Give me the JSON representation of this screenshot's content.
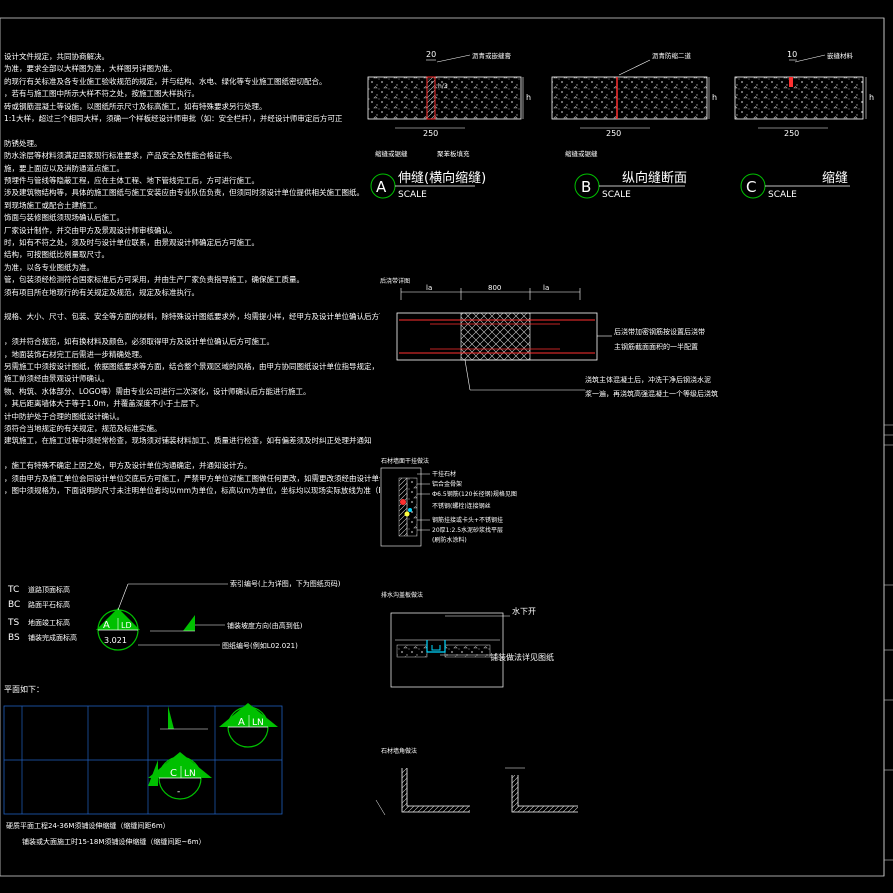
{
  "notes": {
    "lines": [
      "设计文件规定，共同协商解决。",
      "为准，要求全部以大样图为准，大样图另详图为准。",
      "的现行有关标准及各专业施工验收规范的规定，并与结构、水电、绿化等专业施工图纸密切配合。",
      "，若有与施工图中所示大样不符之处，按施工图大样执行。",
      "砖或钢筋混凝土等设施，以图纸所示尺寸及标高施工，如有特殊要求另行处理。",
      "1:1大样，超过三个相同大样，须确一个样板经设计师审批（如：安全栏杆），并经设计师审定后方可正",
      "",
      "防锈处理。",
      "防水涂层等材料须满足国家现行标准要求，产品安全及性能合格证书。",
      "施，要上面应以及消防通道点施工。",
      "预埋件与管线等隐蔽工程，应在主体工程、地下管线完工后，方可进行施工。",
      "涉及建筑物结构等，具体的施工图纸与施工安装应由专业队伍负责，但须同时须设计单位提供相关施工图纸。",
      "到现场施工或配合土建施工。",
      "饰面与装修图纸须现场确认后施工。",
      "厂家设计制作，并交由甲方及景观设计师审核确认。",
      "时，如有不符之处，须及时与设计单位联系，由景观设计师确定后方可施工。",
      "结构，可按图纸比例量取尺寸。",
      "为准，以各专业图纸为准。",
      "管，包装须经检测符合国家标准后方可采用，并由生产厂家负责指导施工，确保施工质量。",
      "须有项目所在地现行的有关规定及规范，规定及标准执行。",
      "",
      "规格、大小、尺寸、包装、安全等方面的材料，除特殊设计图纸要求外，均需提小样，经甲方及设计单位确认后方可采",
      "",
      "，须并符合规范，如有换材料及颜色，必须取得甲方及设计单位确认后方可施工。",
      "，地面装饰石材完工后需进一步精确处理。",
      "另需施工中须按设计图纸，依据图纸要求等方面，结合整个景观区域的风格，由甲方协同图纸设计单位指导规定，",
      "施工前须经由景观设计师确认。",
      "物、构筑、水体部分、LOGO等）需由专业公司进行二次深化，设计师确认后方能进行施工。",
      "，其后距离墙体大于等于1.0m，并覆盖深度不小于土层下。",
      "计中防护处于合理的图纸设计确认。",
      "须符合当地规定的有关规定，规范及标准实施。",
      "建筑施工，在施工过程中须经常检查，现场须对铺装材料加工、质量进行检查，如有偏差须及时纠正处理并通知",
      "",
      "，施工有特殊不确定上因之处，甲方及设计单位沟通确定，并通知设计方。",
      "，须由甲方及施工单位会同设计单位交底后方可施工，严禁甲方单位对施工图做任何更改，如需更改须经由设计单位",
      "，图中须规格为，下面说明的尺寸未注明单位者均以mm为单位，标高以m为单位，坐标均以现场实际放线为准（BCD）"
    ]
  },
  "legend": {
    "rows": [
      {
        "code": "TC",
        "text": "道路顶面标高"
      },
      {
        "code": "BC",
        "text": "路面平石标高"
      },
      {
        "code": "TS",
        "text": "地面竣工标高"
      },
      {
        "code": "BS",
        "text": "铺装完成面标高"
      }
    ],
    "symbol_letter": "A",
    "symbol_code": "LD",
    "symbol_ref": "3.021",
    "callouts": [
      "索引编号(上为详图，下为图纸页码)",
      "铺装坡度方向(由高到低)",
      "图纸编号(例如L02.021)"
    ],
    "section_label": "平面如下："
  },
  "joint_a": {
    "dim_top": "20",
    "dim_bottom": "250",
    "label_top": "沥青或嵌缝膏",
    "label_bl": "缩缝或锯缝",
    "label_br": "聚苯板填充",
    "dim_h": "h",
    "dim_h2": "h/3",
    "letter": "A",
    "title": "伸缝(横向缩缝)",
    "scale": "SCALE"
  },
  "joint_b": {
    "dim_bottom": "250",
    "label_top": "沥青防缩二道",
    "label_bl": "缩缝或锯缝",
    "dim_h": "h",
    "letter": "B",
    "title": "纵向缝断面",
    "scale": "SCALE"
  },
  "joint_c": {
    "dim_top": "10",
    "dim_bottom": "250",
    "label_top": "嵌缝材料",
    "dim_h": "h",
    "letter": "C",
    "title": "缩缝",
    "scale": "SCALE"
  },
  "post_pour": {
    "title": "后浇带详图",
    "dim_left": "la",
    "dim_mid": "800",
    "dim_right": "la",
    "note_right_1": "后浇带加密钢筋按设置后浇带",
    "note_right_2": "主钢筋截面面积的一半配置",
    "note_bottom_1": "浇筑主体混凝土后，冲洗干净后钢浇水泥",
    "note_bottom_2": "浆一遍，再浇筑高强混凝土一个等级后浇筑"
  },
  "wall_detail": {
    "title": "石材墙面干挂做法",
    "labels": [
      "干挂石材",
      "铝合金骨架",
      "Ф6.5钢筋(120长径钢)规格见图",
      "不锈钢(螺栓)连接钢丝",
      "钢筋挂接或卡头+不锈钢挂",
      "20厚1:2.5水泥砂浆找平层",
      "(刷防水涂料)"
    ]
  },
  "water_detail": {
    "title": "排水沟盖板做法",
    "label_top": "水下开",
    "label_mid": "铺装做法详见图纸"
  },
  "corner_detail": {
    "title": "石材墙角做法"
  },
  "plan_demo": {
    "sym1_letter": "A",
    "sym1_code": "LN",
    "sym2_letter": "C",
    "sym2_code": "LN",
    "sym2_ref": "-",
    "note_1": "硬质平面工程24-36M须铺设伸缩缝（缩缝间距6m）",
    "note_2": "铺装或大面施工时15-18M须铺设伸缩缝（缩缝间距~6m）"
  },
  "colors": {
    "background": "#000000",
    "line": "#ffffff",
    "accent_green": "#00c000",
    "accent_red": "#ff2020",
    "accent_yellow": "#ffff40",
    "accent_cyan": "#00d8ff",
    "grid_blue": "#2060c0",
    "hatch": "#c0c0c0"
  }
}
